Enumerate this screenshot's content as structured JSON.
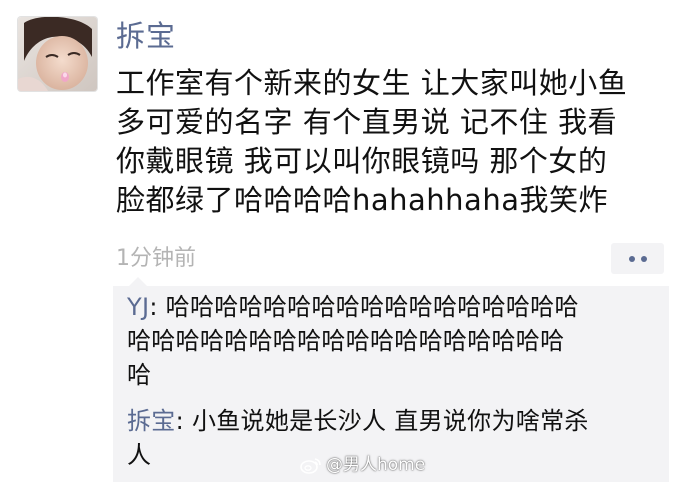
{
  "post": {
    "username": "拆宝",
    "body": "工作室有个新来的女生 让大家叫她小鱼\n 多可爱的名字 有个直男说 记不住 我看\n你戴眼镜 我可以叫你眼镜吗 那个女的\n脸都绿了哈哈哈哈hahahhaha我笑炸",
    "timestamp": "1分钟前"
  },
  "comments": [
    {
      "author": "YJ",
      "separator": ": ",
      "text": "哈哈哈哈哈哈哈哈哈哈哈哈哈哈哈哈哈\n哈哈哈哈哈哈哈哈哈哈哈哈哈哈哈哈哈哈\n哈"
    },
    {
      "author": "拆宝",
      "separator": ": ",
      "text": "小鱼说她是长沙人 直男说你为啥常杀\n人"
    }
  ],
  "watermark": {
    "text": "@男人home"
  },
  "icons": {
    "more": "more-dots-icon",
    "watermark_logo": "weibo-logo-icon"
  },
  "colors": {
    "name_blue": "#5b6b92",
    "timestamp_gray": "#b4b4b4",
    "comment_bg": "#f3f3f5",
    "text": "#111111"
  }
}
